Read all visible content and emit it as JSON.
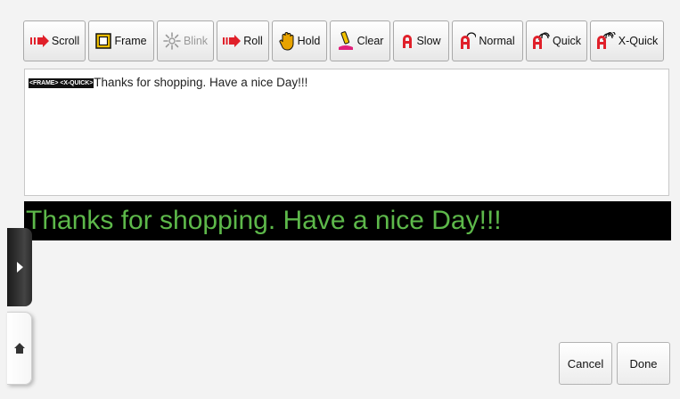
{
  "toolbar": {
    "buttons": [
      {
        "label": "Scroll",
        "icon": "scroll-arrow-icon"
      },
      {
        "label": "Frame",
        "icon": "frame-icon"
      },
      {
        "label": "Blink",
        "icon": "blink-icon",
        "disabled": true
      },
      {
        "label": "Roll",
        "icon": "roll-arrow-icon"
      },
      {
        "label": "Hold",
        "icon": "hold-hand-icon"
      },
      {
        "label": "Clear",
        "icon": "clear-eraser-icon"
      },
      {
        "label": "Slow",
        "icon": "speed-slow-icon"
      },
      {
        "label": "Normal",
        "icon": "speed-normal-icon"
      },
      {
        "label": "Quick",
        "icon": "speed-quick-icon"
      },
      {
        "label": "X-Quick",
        "icon": "speed-xquick-icon"
      }
    ]
  },
  "editor": {
    "tag_frame": "<FRAME>",
    "tag_speed": "<X-QUICK>",
    "text": "Thanks for shopping. Have a nice Day!!!"
  },
  "preview": {
    "text": "Thanks for shopping. Have a nice Day!!!",
    "text_color": "#5db84a",
    "background": "#000000"
  },
  "side": {
    "play_icon": "play-arrow-icon",
    "home_icon": "home-icon"
  },
  "footer": {
    "cancel_label": "Cancel",
    "done_label": "Done"
  },
  "colors": {
    "accent_red": "#e0202a",
    "highlight_yellow": "#f2c200"
  }
}
